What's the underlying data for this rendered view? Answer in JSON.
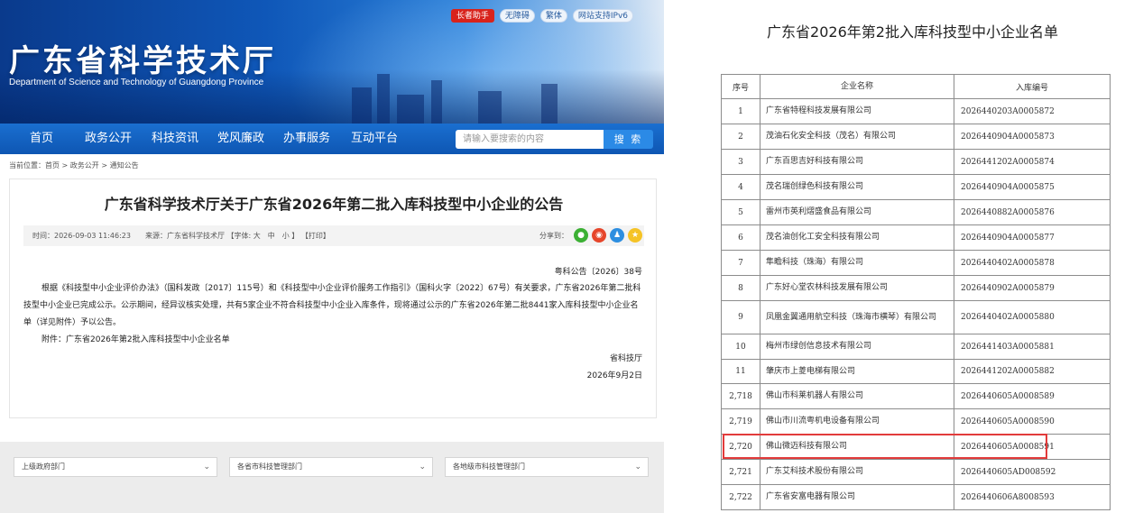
{
  "site": {
    "title": "广东省科学技术厅",
    "subtitle": "Department of Science and Technology of Guangdong Province",
    "top_links": [
      "长者助手",
      "无障碍",
      "繁体",
      "网站支持IPv6"
    ]
  },
  "nav": {
    "items": [
      "首页",
      "政务公开",
      "科技资讯",
      "党风廉政",
      "办事服务",
      "互动平台"
    ],
    "search_placeholder": "请输入要搜索的内容",
    "search_button": "搜 索"
  },
  "breadcrumb": "当前位置：首页 > 政务公开 > 通知公告",
  "article": {
    "title": "广东省科学技术厅关于广东省2026年第二批入库科技型中小企业的公告",
    "meta": "时间：2026-09-03 11:46:23　　来源：广东省科学技术厅 【字体: 大　中　小 】 【打印】",
    "share_label": "分享到：",
    "doc_no": "粤科公告〔2026〕38号",
    "body": "根据《科技型中小企业评价办法》（国科发政〔2017〕115号）和《科技型中小企业评价服务工作指引》（国科火字〔2022〕67号）有关要求，广东省2026年第二批科技型中小企业已完成公示。公示期间，经异议核实处理，共有5家企业不符合科技型中小企业入库条件，现将通过公示的广东省2026年第二批8441家入库科技型中小企业名单（详见附件）予以公告。",
    "attachment": "附件：广东省2026年第2批入库科技型中小企业名单",
    "signature": "省科技厅",
    "date": "2026年9月2日"
  },
  "footer": {
    "selects": [
      "上级政府部门",
      "各省市科技管理部门",
      "各地级市科技管理部门"
    ]
  },
  "list": {
    "title": "广东省2026年第2批入库科技型中小企业名单",
    "headers": [
      "序号",
      "企业名称",
      "入库编号"
    ],
    "rows": [
      {
        "no": "1",
        "name": "广东省特程科技发展有限公司",
        "code": "2026440203A0005872"
      },
      {
        "no": "2",
        "name": "茂油石化安全科技（茂名）有限公司",
        "code": "2026440904A0005873"
      },
      {
        "no": "3",
        "name": "广东百思吉好科技有限公司",
        "code": "2026441202A0005874"
      },
      {
        "no": "4",
        "name": "茂名瑞创绿色科技有限公司",
        "code": "2026440904A0005875"
      },
      {
        "no": "5",
        "name": "雷州市英利熠盛食品有限公司",
        "code": "2026440882A0005876"
      },
      {
        "no": "6",
        "name": "茂名油创化工安全科技有限公司",
        "code": "2026440904A0005877"
      },
      {
        "no": "7",
        "name": "隼瞻科技（珠海）有限公司",
        "code": "2026440402A0005878"
      },
      {
        "no": "8",
        "name": "广东好心堂农林科技发展有限公司",
        "code": "2026440902A0005879"
      },
      {
        "no": "9",
        "name": "凤凰金翼通用航空科技（珠海市横琴）有限公司",
        "code": "2026440402A0005880"
      },
      {
        "no": "10",
        "name": "梅州市绿创信息技术有限公司",
        "code": "2026441403A0005881"
      },
      {
        "no": "11",
        "name": "肇庆市上菱电梯有限公司",
        "code": "2026441202A0005882"
      },
      {
        "no": "2,718",
        "name": "佛山市科莱机器人有限公司",
        "code": "2026440605A0008589"
      },
      {
        "no": "2,719",
        "name": "佛山市川流粤机电设备有限公司",
        "code": "2026440605A0008590"
      },
      {
        "no": "2,720",
        "name": "佛山微迈科技有限公司",
        "code": "2026440605A0008591"
      },
      {
        "no": "2,721",
        "name": "广东艾科技术股份有限公司",
        "code": "2026440605AD008592"
      },
      {
        "no": "2,722",
        "name": "广东省安富电器有限公司",
        "code": "2026440606A8008593"
      }
    ]
  }
}
